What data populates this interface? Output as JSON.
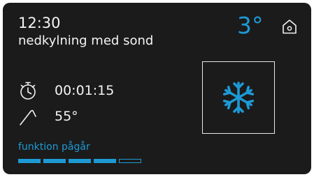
{
  "header": {
    "time": "12:30",
    "program": "nedkylning med sond",
    "temperature": "3°"
  },
  "timer": {
    "icon": "stopwatch-icon",
    "value": "00:01:15"
  },
  "probe": {
    "icon": "core-probe-icon",
    "value": "55°"
  },
  "status": {
    "text": "funktion pågår",
    "progress": {
      "total_segments": 5,
      "completed_segments": 4
    }
  },
  "controls": {
    "home_icon": "home-icon",
    "mode_icon": "snowflake-icon"
  },
  "colors": {
    "background": "#1b1b1b",
    "accent": "#1d9ad6",
    "text": "#f4f4f4"
  }
}
